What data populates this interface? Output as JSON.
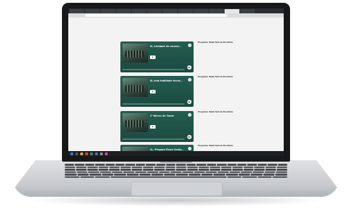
{
  "browser": {
    "tabs": [
      "",
      "",
      "",
      "",
      "",
      "",
      "",
      "",
      "",
      "",
      "",
      ""
    ],
    "url": ""
  },
  "episodes": [
    {
      "card_title": "3L-Unidade de ensino...",
      "info": {
        "heading": "Programa: Natal Fácil de Rondônia",
        "rows": [
          "",
          "",
          "",
          "",
          ""
        ]
      }
    },
    {
      "card_title": "4L-nna tvalidade tecno...",
      "info": {
        "heading": "Programa: Natal Fácil de Rondônia",
        "rows": [
          "",
          "",
          "",
          ""
        ]
      }
    },
    {
      "card_title": "1º Mercu de Tarde",
      "info": {
        "heading": "Programa: Natal Fácil de Rondônia",
        "rows": [
          "",
          "",
          "",
          "",
          ""
        ]
      }
    },
    {
      "card_title": "1L. Preparo Econ Verão...",
      "info": {
        "heading": "Programa: Natal Fácil de Rondônia",
        "rows": [
          "",
          ""
        ]
      }
    }
  ],
  "colors": {
    "card_green": "#1b4a40",
    "accent": "#245e51"
  },
  "icons": {
    "share": "share-icon",
    "play": "play-icon"
  }
}
